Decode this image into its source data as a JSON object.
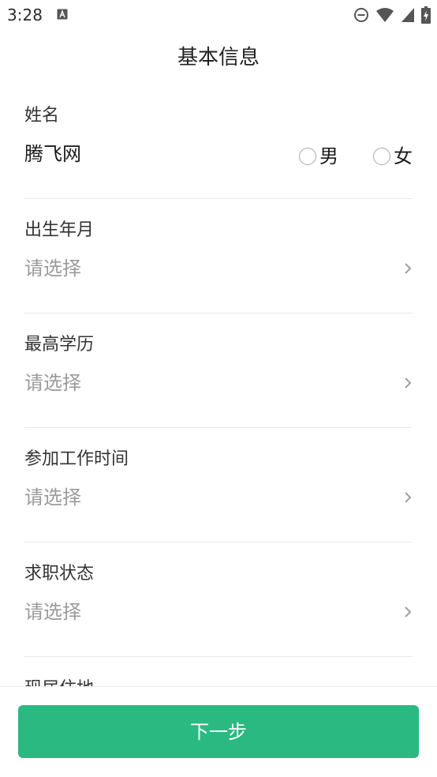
{
  "status_bar": {
    "time": "3:28",
    "icons": [
      "notification-a-icon",
      "dnd-icon",
      "wifi-icon",
      "cellular-icon",
      "battery-charging-icon"
    ]
  },
  "header": {
    "title": "基本信息"
  },
  "form": {
    "name": {
      "label": "姓名",
      "value": "腾飞网",
      "gender_options": [
        "男",
        "女"
      ]
    },
    "fields": [
      {
        "label": "出生年月",
        "placeholder": "请选择"
      },
      {
        "label": "最高学历",
        "placeholder": "请选择"
      },
      {
        "label": "参加工作时间",
        "placeholder": "请选择"
      },
      {
        "label": "求职状态",
        "placeholder": "请选择"
      }
    ],
    "partial_next_label": "现居住地"
  },
  "footer": {
    "next_label": "下一步"
  },
  "colors": {
    "accent": "#2bb982",
    "placeholder": "#9a9a9a",
    "divider": "#e8e8e8"
  }
}
